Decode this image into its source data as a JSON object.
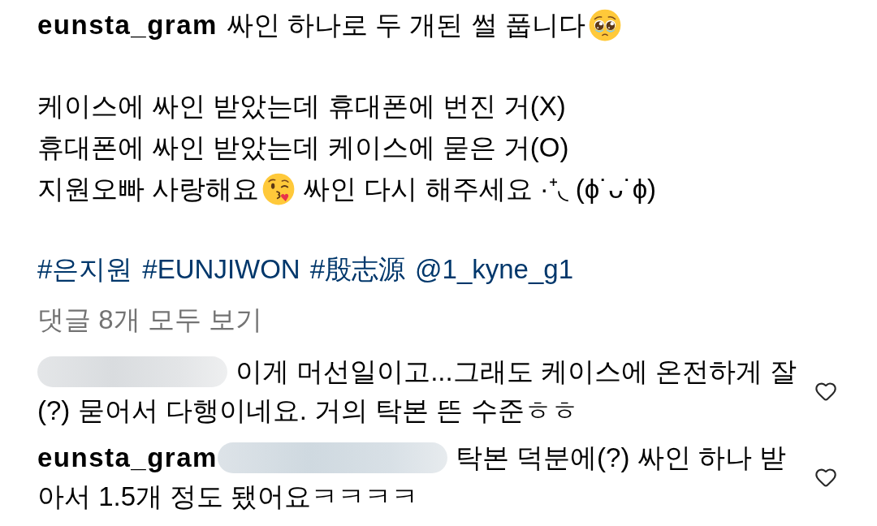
{
  "caption": {
    "username": "eunsta_gram",
    "title": [
      {
        "kind": "text",
        "text": "싸인 하나로 두 개된 썰 풉니다"
      },
      {
        "kind": "teary"
      }
    ],
    "lines": [
      [
        {
          "kind": "text",
          "text": "케이스에 싸인 받았는데 휴대폰에 번진 거(X)"
        }
      ],
      [
        {
          "kind": "text",
          "text": "휴대폰에 싸인 받았는데 케이스에 묻은 거(O)"
        }
      ],
      [
        {
          "kind": "text",
          "text": "지원오빠 사랑해요"
        },
        {
          "kind": "kiss"
        },
        {
          "kind": "text",
          "text": "싸인 다시 해주세요 ·⁺◟ (ϕ˙ᴗ˙ϕ)"
        }
      ]
    ]
  },
  "tags": [
    "#은지원",
    "#EUNJIWON",
    "#殷志源",
    "@1_kyne_g1"
  ],
  "view_all_comments": "댓글 8개 모두 보기",
  "comments": [
    {
      "author_blurred": true,
      "lines": [
        "이게 머선일이고...그래도 케이스에 온전하게 잘",
        "(?) 묻어서 다행이네요. 거의 탁본 뜬 수준ㅎㅎ"
      ],
      "liked": false
    },
    {
      "author": "eunsta_gram",
      "mention_blurred": true,
      "lines": [
        "탁본 덕분에(?) 싸인 하나 받",
        "아서 1.5개 정도 됐어요ㅋㅋㅋㅋ"
      ],
      "liked": false
    }
  ]
}
